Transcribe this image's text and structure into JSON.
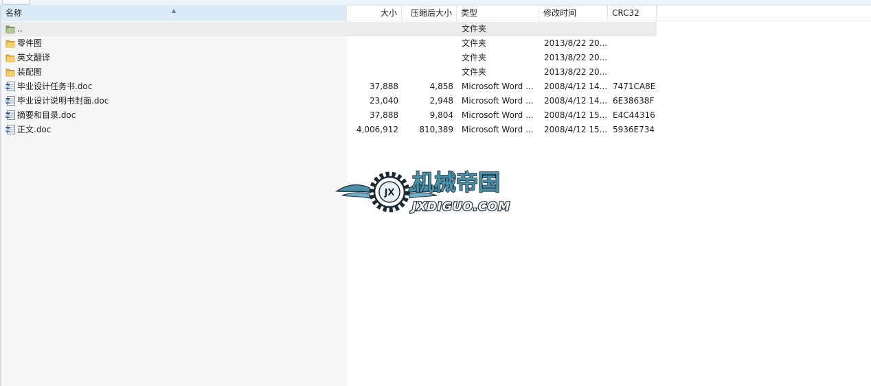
{
  "columns": {
    "name": "名称",
    "size": "大小",
    "packed": "压缩后大小",
    "type": "类型",
    "modified": "修改时间",
    "crc": "CRC32"
  },
  "rows": [
    {
      "name": "..",
      "size": "",
      "packed": "",
      "type": "文件夹",
      "modified": "",
      "crc": "",
      "icon": "parent-folder-icon"
    },
    {
      "name": "零件图",
      "size": "",
      "packed": "",
      "type": "文件夹",
      "modified": "2013/8/22 20...",
      "crc": "",
      "icon": "folder-icon"
    },
    {
      "name": "英文翻译",
      "size": "",
      "packed": "",
      "type": "文件夹",
      "modified": "2013/8/22 20...",
      "crc": "",
      "icon": "folder-icon"
    },
    {
      "name": "装配图",
      "size": "",
      "packed": "",
      "type": "文件夹",
      "modified": "2013/8/22 20...",
      "crc": "",
      "icon": "folder-icon"
    },
    {
      "name": "毕业设计任务书.doc",
      "size": "37,888",
      "packed": "4,858",
      "type": "Microsoft Word ...",
      "modified": "2008/4/12 14...",
      "crc": "7471CA8E",
      "icon": "word-doc-icon"
    },
    {
      "name": "毕业设计说明书封面.doc",
      "size": "23,040",
      "packed": "2,948",
      "type": "Microsoft Word ...",
      "modified": "2008/4/12 14...",
      "crc": "6E38638F",
      "icon": "word-doc-icon"
    },
    {
      "name": "摘要和目录.doc",
      "size": "37,888",
      "packed": "9,804",
      "type": "Microsoft Word ...",
      "modified": "2008/4/12 15...",
      "crc": "E4C44316",
      "icon": "word-doc-icon"
    },
    {
      "name": "正文.doc",
      "size": "4,006,912",
      "packed": "810,389",
      "type": "Microsoft Word ...",
      "modified": "2008/4/12 15...",
      "crc": "5936E734",
      "icon": "word-doc-icon"
    }
  ],
  "watermark": {
    "title": "机械帝国",
    "subtitle": "JXDIGUO.COM",
    "badge": "JX"
  },
  "colors": {
    "selected_row": "#ececec",
    "sort_column_bg": "#dcebf8",
    "folder": "#f0c24b",
    "watermark": "#4a8fa8"
  }
}
